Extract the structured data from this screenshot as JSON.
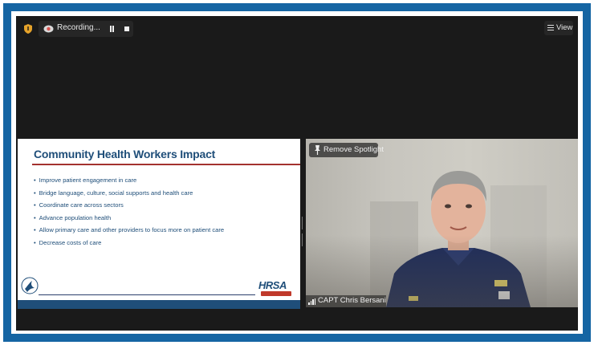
{
  "toolbar": {
    "shield_icon": "shield-icon",
    "recording_icon": "cloud-recording-icon",
    "recording_label": "Recording...",
    "pause_icon": "pause-icon",
    "stop_icon": "stop-icon",
    "view_icon": "view-grid-icon",
    "view_label": "View"
  },
  "slide": {
    "title": "Community Health Workers Impact",
    "bullets": [
      "Improve patient engagement in care",
      "Bridge language, culture, social supports and health care",
      "Coordinate care across sectors",
      "Advance population health",
      "Allow primary care and other providers to focus more on patient care",
      "Decrease costs of care"
    ],
    "left_logo": "hhs-eagle-logo",
    "right_logo": "HRSA",
    "accent_color": "#a3322e",
    "brand_color": "#1f4e79"
  },
  "video": {
    "remove_spotlight_label": "Remove Spotlight",
    "participant_name": "CAPT Chris Bersani",
    "signal_icon": "signal-strength-icon",
    "pin_icon": "pin-icon"
  },
  "colors": {
    "frame": "#1565a3",
    "window": "#1a1a1a"
  }
}
